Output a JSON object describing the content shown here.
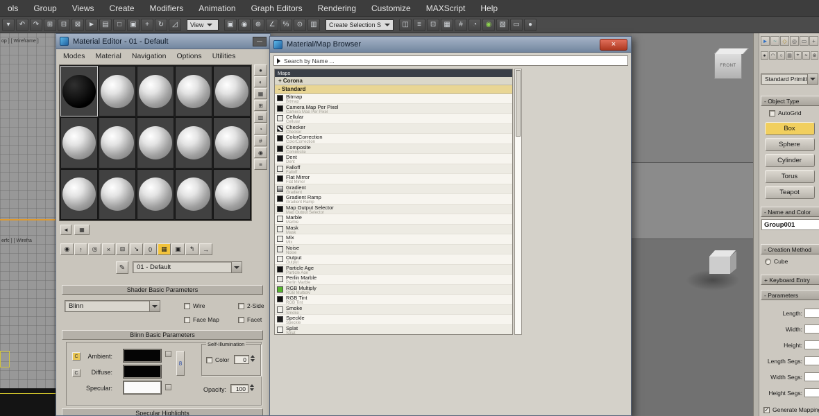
{
  "menubar": {
    "items": [
      "ols",
      "Group",
      "Views",
      "Create",
      "Modifiers",
      "Animation",
      "Graph Editors",
      "Rendering",
      "Customize",
      "MAXScript",
      "Help"
    ]
  },
  "main_toolbar": {
    "ref_coord_value": "View",
    "selection_set_value": "Create Selection S",
    "icons_a": [
      {
        "g": "▾",
        "n": "flyout-arrow-icon"
      },
      {
        "g": "↶",
        "n": "undo-icon"
      },
      {
        "g": "↷",
        "n": "redo-icon"
      },
      {
        "g": "⊞",
        "n": "select-and-link-icon"
      },
      {
        "g": "⊟",
        "n": "unlink-selection-icon"
      },
      {
        "g": "⊠",
        "n": "bind-to-space-warp-icon"
      },
      {
        "g": "►",
        "n": "select-object-icon"
      },
      {
        "g": "▤",
        "n": "select-by-name-icon"
      },
      {
        "g": "□",
        "n": "rectangular-selection-region-icon"
      },
      {
        "g": "▣",
        "n": "window-crossing-icon"
      },
      {
        "g": "+",
        "n": "select-and-move-icon"
      },
      {
        "g": "↻",
        "n": "select-and-rotate-icon"
      },
      {
        "g": "◿",
        "n": "select-and-scale-icon"
      }
    ],
    "icons_b": [
      {
        "g": "▣",
        "n": "use-pivot-point-center-icon"
      },
      {
        "g": "◉",
        "n": "select-and-manipulate-icon"
      },
      {
        "g": "⊕",
        "n": "snaps-toggle-icon"
      },
      {
        "g": "∠",
        "n": "angle-snap-toggle-icon"
      },
      {
        "g": "%",
        "n": "percent-snap-toggle-icon"
      },
      {
        "g": "⊙",
        "n": "spinner-snap-toggle-icon"
      },
      {
        "g": "▥",
        "n": "named-selection-sets-icon"
      }
    ],
    "icons_c": [
      {
        "g": "◫",
        "n": "mirror-icon"
      },
      {
        "g": "≡",
        "n": "align-icon"
      },
      {
        "g": "⊡",
        "n": "layer-manager-icon"
      },
      {
        "g": "▦",
        "n": "graphite-ribbon-icon"
      },
      {
        "g": "#",
        "n": "curve-editor-icon"
      },
      {
        "g": "◔",
        "n": "schematic-view-icon"
      },
      {
        "g": "◉",
        "n": "material-editor-icon",
        "c": "#8cd14e"
      },
      {
        "g": "▧",
        "n": "render-setup-icon"
      },
      {
        "g": "▭",
        "n": "rendered-frame-window-icon"
      },
      {
        "g": "●",
        "n": "render-production-icon"
      }
    ]
  },
  "viewport_left": {
    "top_label": "op ]  [ Wireframe ]",
    "bottom_label": "erfc ]  [ Wirefra"
  },
  "viewport_right": {
    "viewcube_label": "FRONT"
  },
  "material_editor": {
    "title": "Material Editor - 01 - Default",
    "minimize_glyph": "—",
    "menu": [
      "Modes",
      "Material",
      "Navigation",
      "Options",
      "Utilities"
    ],
    "nav_back_glyph": "◄",
    "palette_glyph": "▦",
    "toolbar_icons": [
      {
        "g": "◉",
        "n": "get-material-icon"
      },
      {
        "g": "↑",
        "n": "put-material-to-scene-icon"
      },
      {
        "g": "◎",
        "n": "assign-material-to-selection-icon"
      },
      {
        "g": "×",
        "n": "reset-map-icon"
      },
      {
        "g": "⊟",
        "n": "make-material-copy-icon"
      },
      {
        "g": "↘",
        "n": "put-to-library-icon"
      },
      {
        "g": "0",
        "n": "material-id-channel-icon"
      },
      {
        "g": "▦",
        "n": "show-map-in-viewport-icon",
        "bg": "#f2c33c"
      },
      {
        "g": "▣",
        "n": "show-end-result-icon"
      },
      {
        "g": "↰",
        "n": "go-to-parent-icon"
      },
      {
        "g": "→",
        "n": "go-forward-to-sibling-icon"
      }
    ],
    "side_icons": [
      {
        "g": "●",
        "n": "sample-type-icon"
      },
      {
        "g": "◐",
        "n": "backlight-icon"
      },
      {
        "g": "▦",
        "n": "background-icon"
      },
      {
        "g": "⊞",
        "n": "sample-uv-tiling-icon"
      },
      {
        "g": "▥",
        "n": "video-color-check-icon"
      },
      {
        "g": "◔",
        "n": "make-preview-icon"
      },
      {
        "g": "#",
        "n": "material-editor-options-icon"
      },
      {
        "g": "◉",
        "n": "select-by-material-icon"
      },
      {
        "g": "≡",
        "n": "material-map-navigator-icon"
      }
    ],
    "picker_glyph": "✎",
    "material_name": "01 - Default",
    "shader_rollout": "Shader Basic Parameters",
    "shader_value": "Blinn",
    "cb_wire": "Wire",
    "cb_2side": "2-Side",
    "cb_facemap": "Face Map",
    "cb_facet": "Facet",
    "basic_rollout": "Blinn Basic Parameters",
    "ambient_label": "Ambient:",
    "diffuse_label": "Diffuse:",
    "specular_label": "Specular:",
    "lock_glyph": "C",
    "lock_link_glyph": "8",
    "selfillum_title": "Self-Illumination",
    "selfillum_color_label": "Color",
    "selfillum_value": "0",
    "opacity_label": "Opacity:",
    "opacity_value": "100",
    "highlights_rollout": "Specular Highlights"
  },
  "map_browser": {
    "title": "Material/Map Browser",
    "close_glyph": "×",
    "search_text": "Search by Name ...",
    "group_maps": "Maps",
    "group_corona": "+ Corona",
    "group_standard": "- Standard",
    "items": [
      {
        "name": "Bitmap",
        "icon": "#101010"
      },
      {
        "name": "Camera Map Per Pixel",
        "icon": "#101010"
      },
      {
        "name": "Cellular",
        "icon": "#e9e8e2"
      },
      {
        "name": "Checker",
        "icon": "linear-gradient(45deg,#111 25%,#f4f4f4 25%,#f4f4f4 50%,#111 50%,#111 75%,#f4f4f4 75%)"
      },
      {
        "name": "ColorCorrection",
        "icon": "#101010"
      },
      {
        "name": "Composite",
        "icon": "#101010"
      },
      {
        "name": "Dent",
        "icon": "#18181b"
      },
      {
        "name": "Falloff",
        "icon": "#f0efe9"
      },
      {
        "name": "Flat Mirror",
        "icon": "#101010"
      },
      {
        "name": "Gradient",
        "icon": "linear-gradient(#f4f4f2,#5d5d5d)"
      },
      {
        "name": "Gradient Ramp",
        "icon": "#101010"
      },
      {
        "name": "Map Output Selector",
        "icon": "#101010"
      },
      {
        "name": "Marble",
        "icon": "#edece6"
      },
      {
        "name": "Mask",
        "icon": "#f2f1eb"
      },
      {
        "name": "Mix",
        "icon": "#efeee8"
      },
      {
        "name": "Noise",
        "icon": "#ecebe5"
      },
      {
        "name": "Output",
        "icon": "#f1f0ea"
      },
      {
        "name": "Particle Age",
        "icon": "#101010"
      },
      {
        "name": "Perlin Marble",
        "icon": "#eae9e3"
      },
      {
        "name": "RGB Multiply",
        "icon": "#56b42d"
      },
      {
        "name": "RGB Tint",
        "icon": "#101010"
      },
      {
        "name": "Smoke",
        "icon": "#f1f0ea"
      },
      {
        "name": "Speckle",
        "icon": "#1d1d1d"
      },
      {
        "name": "Splat",
        "icon": "#f3f2ec"
      }
    ]
  },
  "command_panel": {
    "tabs": [
      {
        "g": "►",
        "n": "create-tab-icon",
        "c": "#2f6fc4"
      },
      {
        "g": "~",
        "n": "modify-tab-icon",
        "c": "#3f8f8f"
      },
      {
        "g": "◇",
        "n": "hierarchy-tab-icon",
        "c": "#b08f2f"
      },
      {
        "g": "◎",
        "n": "motion-tab-icon",
        "c": "#555555"
      },
      {
        "g": "▭",
        "n": "display-tab-icon",
        "c": "#555555"
      },
      {
        "g": "+",
        "n": "utilities-tab-icon",
        "c": "#555555"
      }
    ],
    "subtabs": [
      {
        "g": "●",
        "n": "geometry-category-icon"
      },
      {
        "g": "◠",
        "n": "shapes-category-icon"
      },
      {
        "g": "○",
        "n": "lights-category-icon"
      },
      {
        "g": "▥",
        "n": "cameras-category-icon"
      },
      {
        "g": "⌖",
        "n": "helpers-category-icon"
      },
      {
        "g": "≈",
        "n": "space-warps-category-icon"
      },
      {
        "g": "⊛",
        "n": "systems-category-icon"
      }
    ],
    "category_value": "Standard Primitives",
    "object_type_rollout": "- Object Type",
    "autogrid_label": "AutoGrid",
    "buttons": [
      {
        "label": "Box",
        "n": "box-button",
        "bg": "#f1cf5e"
      },
      {
        "label": "Sphere",
        "n": "sphere-button"
      },
      {
        "label": "Cylinder",
        "n": "cylinder-button"
      },
      {
        "label": "Torus",
        "n": "torus-button"
      },
      {
        "label": "Teapot",
        "n": "teapot-button"
      }
    ],
    "name_rollout": "- Name and Color",
    "name_value": "Group001",
    "creation_rollout": "- Creation Method",
    "creation_option": "Cube",
    "keyboard_rollout": "+ Keyboard Entry",
    "parameters_rollout": "- Parameters",
    "fields": [
      "Length:",
      "Width:",
      "Height:",
      "Length Segs:",
      "Width Segs:",
      "Height Segs:"
    ],
    "generate_mapping_label": "Generate Mapping Coords.",
    "check_glyph": "✓"
  }
}
